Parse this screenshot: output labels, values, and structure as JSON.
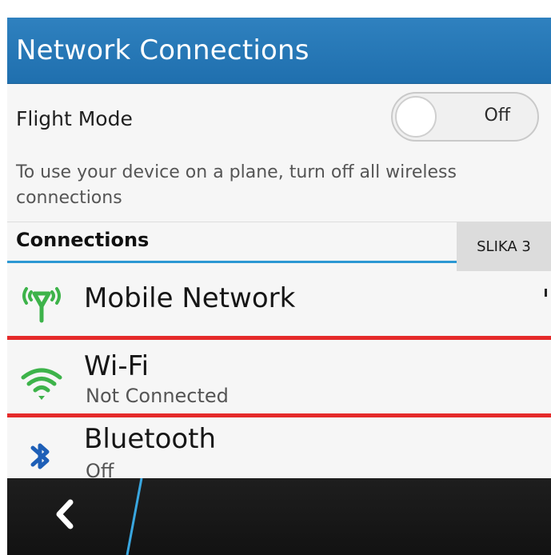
{
  "title": "Network Connections",
  "flight_mode": {
    "label": "Flight Mode",
    "toggle_value": "Off",
    "hint": "To use your device on a plane, turn off all wireless connections"
  },
  "section_header": "Connections",
  "corner_label": "SLIKA 3",
  "connections": [
    {
      "title": "Mobile Network",
      "subtitle": ""
    },
    {
      "title": "Wi-Fi",
      "subtitle": "Not Connected"
    },
    {
      "title": "Bluetooth",
      "subtitle": "Off"
    }
  ],
  "colors": {
    "accent": "#2f81bf",
    "green": "#3db34a",
    "bluetooth": "#1e5fb7",
    "highlight": "#e52a2a"
  },
  "icons": {
    "mobile": "mobile-network-icon",
    "wifi": "wifi-icon",
    "bluetooth": "bluetooth-icon",
    "back": "back-arrow-icon"
  }
}
